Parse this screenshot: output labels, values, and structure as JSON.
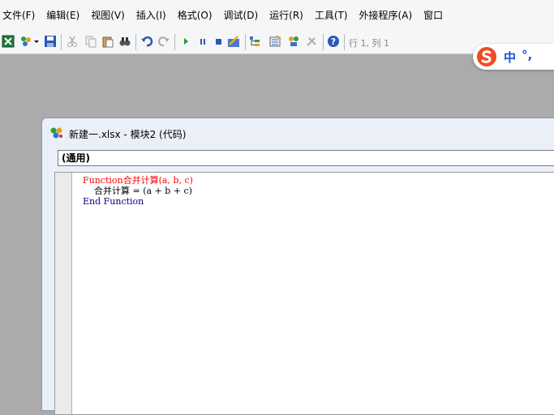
{
  "menu": {
    "items": [
      "文件(F)",
      "编辑(E)",
      "视图(V)",
      "插入(I)",
      "格式(O)",
      "调试(D)",
      "运行(R)",
      "工具(T)",
      "外接程序(A)",
      "窗口"
    ]
  },
  "toolbar": {
    "icons": [
      "excel-icon",
      "insert-module-icon",
      "dropdown-arrow-icon",
      "save-icon",
      "cut-icon",
      "copy-icon",
      "paste-icon",
      "find-icon",
      "undo-icon",
      "redo-icon",
      "run-icon",
      "break-icon",
      "reset-icon",
      "design-mode-icon",
      "project-explorer-icon",
      "properties-icon",
      "object-browser-icon",
      "toolbox-icon",
      "help-icon"
    ],
    "status_hint": "行 1, 列 1"
  },
  "ime": {
    "mode": "中",
    "punct": "°,"
  },
  "code_window": {
    "title": "新建一.xlsx - 模块2 (代码)",
    "object_combo": "(通用)",
    "code": {
      "line1": {
        "kw": "Function",
        "rest": "合并计算(a, b, c)"
      },
      "line2": "    合并计算 = (a + b + c)",
      "line3": {
        "kw": "End Function"
      }
    }
  },
  "colors": {
    "keyword": "#00007f",
    "error": "#ff0000",
    "workspace": "#ababab"
  }
}
